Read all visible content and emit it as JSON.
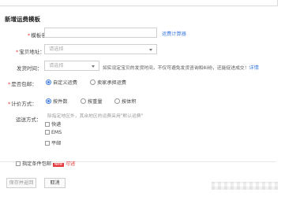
{
  "page_title": "新增运费模板",
  "fields": {
    "template_name": {
      "label": "模板名称：",
      "value": "",
      "link": "运费计算器"
    },
    "ship_from": {
      "label": "宝贝地址：",
      "placeholder": "请选择"
    },
    "ship_time": {
      "label": "发货时间：",
      "placeholder": "请选择",
      "note": "如实设定宝贝的发货时间，不仅可避免发货咨询和纠纷，还能促进成交！",
      "note_link": "详情"
    },
    "free_shipping": {
      "label": "是否包邮：",
      "options": [
        "自定义运费",
        "卖家承担运费"
      ],
      "selected": "自定义运费"
    },
    "pricing_method": {
      "label": "计价方式：",
      "options": [
        "按件数",
        "按重量",
        "按体积"
      ],
      "selected": "按件数"
    },
    "shipping_method": {
      "label": "运送方式：",
      "hint": "除指定地区外，其余地区的运费采用\"默认运费\"",
      "options": [
        "快递",
        "EMS",
        "平邮"
      ]
    }
  },
  "conditional_free": {
    "label": "指定条件包邮",
    "badge": "New",
    "suffix": "可选"
  },
  "buttons": {
    "save": "保存并返回",
    "cancel": "取消"
  },
  "colors": {
    "accent": "#3d7ae0",
    "required": "#e4393c"
  },
  "icons": {
    "dropdown": "chevron-down-icon"
  }
}
